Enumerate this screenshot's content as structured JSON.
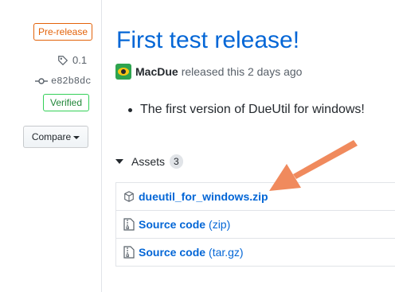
{
  "sidebar": {
    "prerelease_label": "Pre-release",
    "tag": "0.1",
    "commit": "e82b8dc",
    "verified_label": "Verified",
    "compare_label": "Compare"
  },
  "release": {
    "title": "First test release!",
    "author": "MacDue",
    "released_text": "released this 2 days ago",
    "notes": [
      "The first version of DueUtil for windows!"
    ]
  },
  "assets": {
    "heading": "Assets",
    "count": "3",
    "items": [
      {
        "name": "dueutil_for_windows.zip",
        "suffix": ""
      },
      {
        "name": "Source code",
        "suffix": "(zip)"
      },
      {
        "name": "Source code",
        "suffix": "(tar.gz)"
      }
    ]
  },
  "colors": {
    "link": "#0366d6",
    "prerelease": "#e36209",
    "verified": "#22863a",
    "annotation_arrow": "#f08a5d"
  },
  "icons": [
    "tag-icon",
    "commit-icon",
    "package-icon",
    "file-zip-icon",
    "caret-down-icon",
    "triangle-down-icon",
    "eye-avatar-icon"
  ]
}
